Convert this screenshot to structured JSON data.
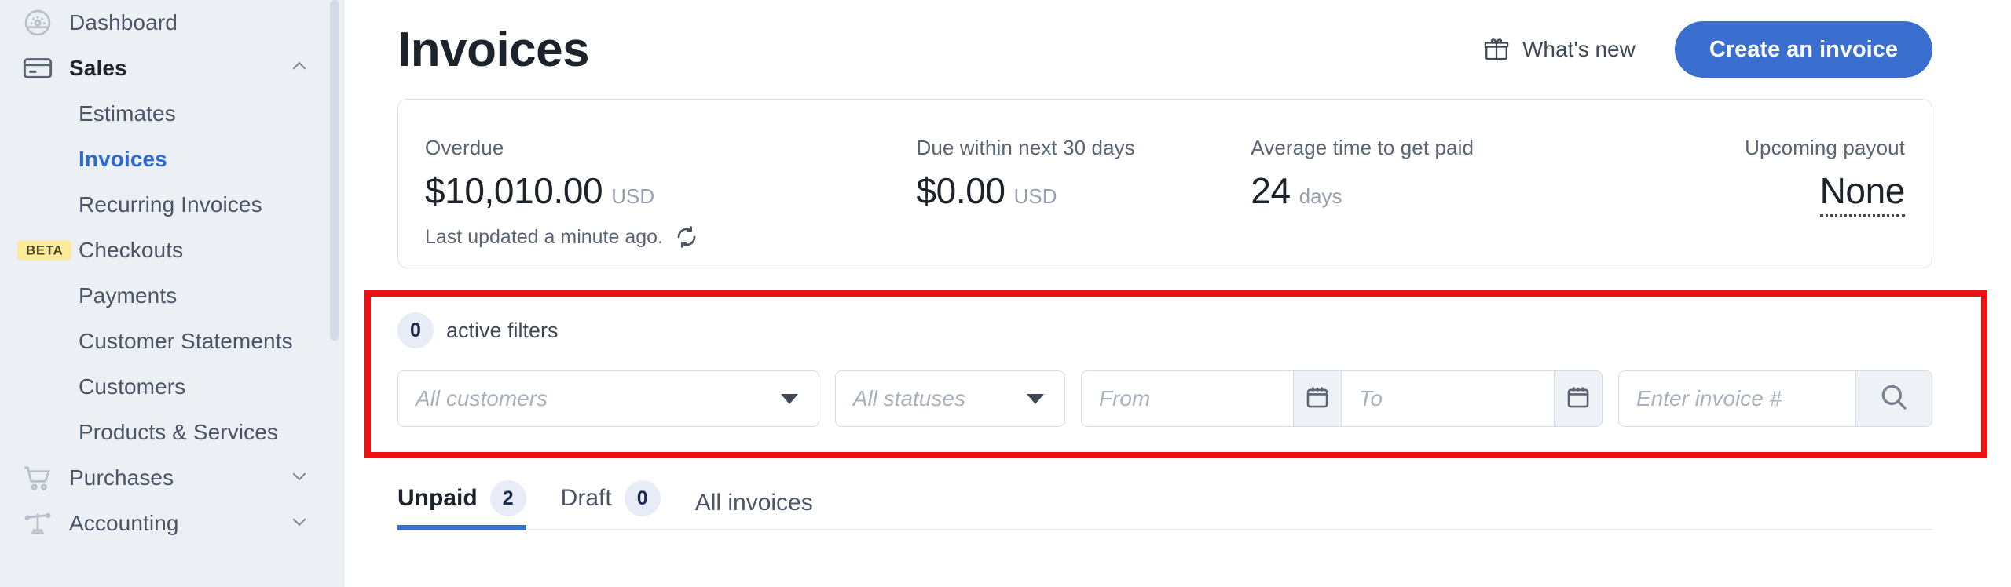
{
  "sidebar": {
    "items": [
      {
        "label": "Dashboard",
        "icon": "gauge-icon",
        "type": "top",
        "expandable": false
      },
      {
        "label": "Sales",
        "icon": "credit-card-icon",
        "type": "top",
        "expandable": true,
        "expanded": true,
        "active": true
      },
      {
        "label": "Estimates",
        "type": "sub"
      },
      {
        "label": "Invoices",
        "type": "sub",
        "selected": true,
        "highlighted": true
      },
      {
        "label": "Recurring Invoices",
        "type": "sub"
      },
      {
        "label": "Checkouts",
        "type": "sub",
        "badge": "BETA"
      },
      {
        "label": "Payments",
        "type": "sub"
      },
      {
        "label": "Customer Statements",
        "type": "sub"
      },
      {
        "label": "Customers",
        "type": "sub"
      },
      {
        "label": "Products & Services",
        "type": "sub"
      },
      {
        "label": "Purchases",
        "icon": "shopping-cart-icon",
        "type": "top",
        "expandable": true
      },
      {
        "label": "Accounting",
        "icon": "scale-icon",
        "type": "top",
        "expandable": true
      }
    ]
  },
  "header": {
    "title": "Invoices",
    "whats_new_label": "What's new",
    "create_invoice_label": "Create an invoice"
  },
  "summary": {
    "stats": [
      {
        "label": "Overdue",
        "amount": "$10,010.00",
        "unit": "USD"
      },
      {
        "label": "Due within next 30 days",
        "amount": "$0.00",
        "unit": "USD"
      },
      {
        "label": "Average time to get paid",
        "amount": "24",
        "unit": "days"
      },
      {
        "label": "Upcoming payout",
        "amount": "None",
        "unit": ""
      }
    ],
    "last_updated": "Last updated a minute ago."
  },
  "filters": {
    "active_count": "0",
    "active_label": "active filters",
    "customers_placeholder": "All customers",
    "statuses_placeholder": "All statuses",
    "from_placeholder": "From",
    "to_placeholder": "To",
    "invoice_placeholder": "Enter invoice #"
  },
  "tabs": [
    {
      "label": "Unpaid",
      "count": "2",
      "active": true
    },
    {
      "label": "Draft",
      "count": "0",
      "active": false
    },
    {
      "label": "All invoices",
      "count": null,
      "active": false
    }
  ],
  "colors": {
    "accent": "#3a6fd0",
    "sidebar_bg": "#eceff4",
    "highlight": "#ee1111",
    "beta_badge": "#fbeb9b"
  }
}
